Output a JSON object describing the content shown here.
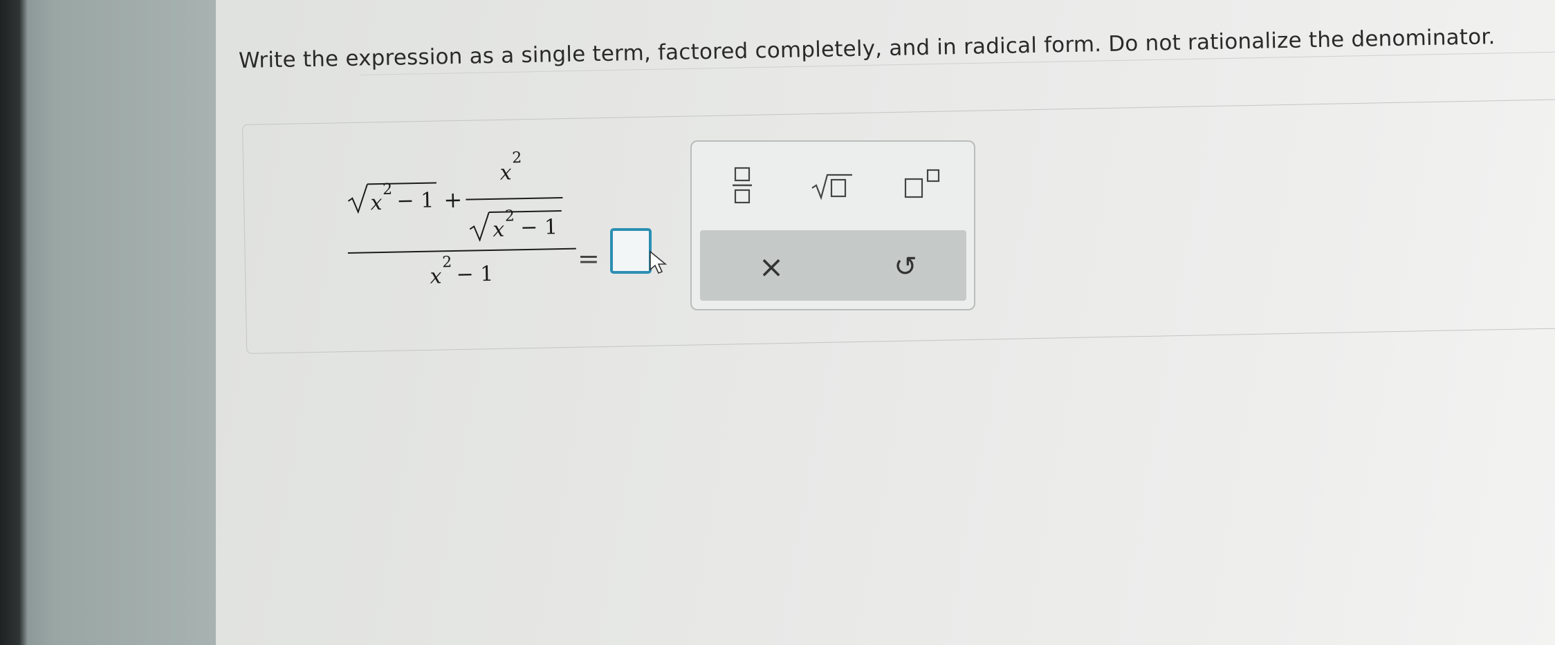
{
  "question": {
    "instruction": "Write the expression as a single term, factored completely, and in radical form. Do not rationalize the denominator."
  },
  "expression": {
    "num_x": "x",
    "num_exp": "2",
    "num_minus_one": "− 1",
    "plus": "+",
    "inner_num_x": "x",
    "inner_num_exp": "2",
    "inner_den_x": "x",
    "inner_den_exp": "2",
    "inner_den_minus_one": "− 1",
    "den_x": "x",
    "den_exp": "2",
    "den_minus_one": "− 1",
    "equals": "="
  },
  "answer": {
    "value": ""
  },
  "toolbar": {
    "fraction_icon": "fraction-icon",
    "sqrt_icon": "square-root-icon",
    "power_icon": "exponent-icon",
    "clear_icon": "close-icon",
    "clear_glyph": "×",
    "undo_icon": "undo-icon",
    "undo_glyph": "↺"
  },
  "colors": {
    "answer_border": "#2c8fb3",
    "toolbar_bottom": "#c5c9c8"
  }
}
